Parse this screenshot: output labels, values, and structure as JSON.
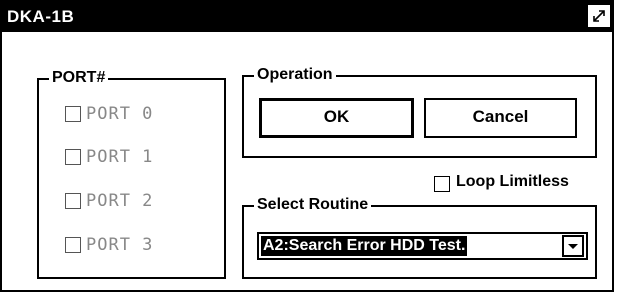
{
  "window": {
    "title": "DKA-1B"
  },
  "ports": {
    "legend": "PORT#",
    "items": [
      {
        "label": "PORT 0",
        "checked": false
      },
      {
        "label": "PORT 1",
        "checked": false
      },
      {
        "label": "PORT 2",
        "checked": false
      },
      {
        "label": "PORT 3",
        "checked": false
      }
    ]
  },
  "operation": {
    "legend": "Operation",
    "ok_label": "OK",
    "cancel_label": "Cancel"
  },
  "loop_limitless": {
    "label": "Loop Limitless",
    "checked": false
  },
  "routine": {
    "legend": "Select Routine",
    "selected": "A2:Search Error HDD Test."
  },
  "icons": {
    "resize": "resize-icon",
    "dropdown": "chevron-down-icon"
  },
  "colors": {
    "titlebar_bg": "#000000",
    "disabled_text": "#888888",
    "selection_bg": "#000000"
  }
}
